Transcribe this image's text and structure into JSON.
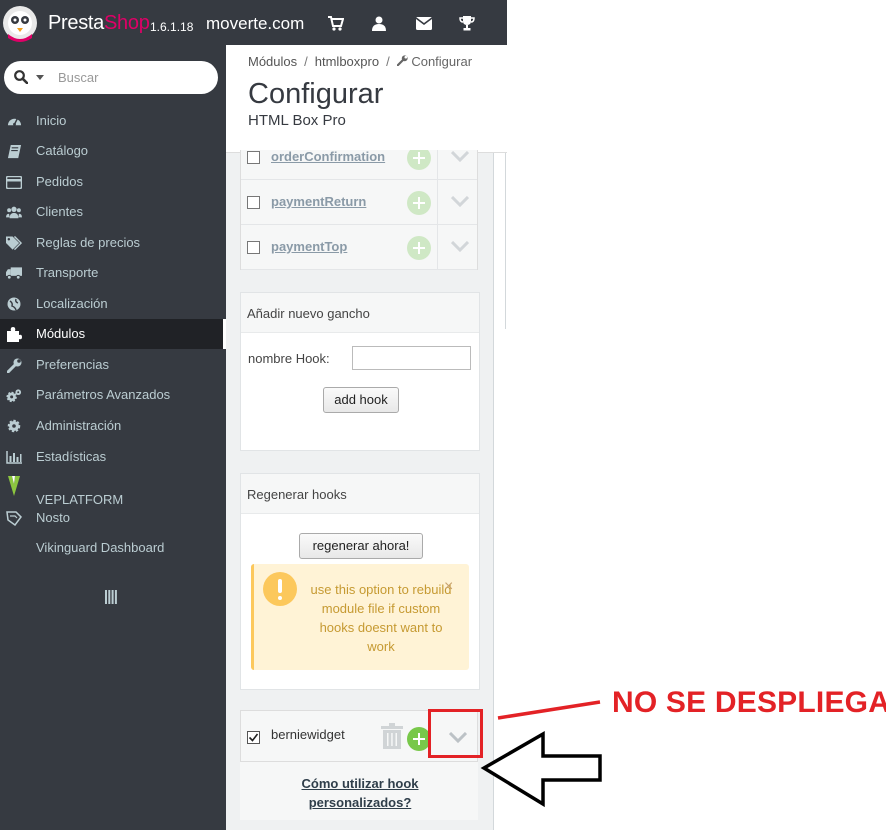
{
  "topbar": {
    "brand_presta": "Presta",
    "brand_shop": "Shop",
    "version": "1.6.1.18",
    "shop_name": "moverte.com",
    "icons": [
      "cart-icon",
      "user-icon",
      "envelope-icon",
      "trophy-icon"
    ]
  },
  "sidebar": {
    "search_placeholder": "Buscar",
    "items": [
      {
        "label": "Inicio",
        "icon": "dashboard-icon"
      },
      {
        "label": "Catálogo",
        "icon": "book-icon"
      },
      {
        "label": "Pedidos",
        "icon": "credit-card-icon"
      },
      {
        "label": "Clientes",
        "icon": "users-icon"
      },
      {
        "label": "Reglas de precios",
        "icon": "tags-icon"
      },
      {
        "label": "Transporte",
        "icon": "truck-icon"
      },
      {
        "label": "Localización",
        "icon": "globe-icon"
      },
      {
        "label": "Módulos",
        "icon": "puzzle-icon",
        "active": true
      },
      {
        "label": "Preferencias",
        "icon": "wrench-icon"
      },
      {
        "label": "Parámetros Avanzados",
        "icon": "cogs-icon"
      },
      {
        "label": "Administración",
        "icon": "cog-icon"
      },
      {
        "label": "Estadísticas",
        "icon": "bar-chart-icon"
      },
      {
        "label": "VEPLATFORM",
        "icon": "veplatform-logo-icon"
      },
      {
        "label": "Nosto",
        "icon": "nosto-icon"
      },
      {
        "label": "Vikinguard Dashboard",
        "icon": ""
      }
    ]
  },
  "header": {
    "breadcrumb": [
      "Módulos",
      "htmlboxpro",
      "Configurar"
    ],
    "title": "Configurar",
    "subtitle": "HTML Box Pro"
  },
  "hooks": [
    "orderConfirmation",
    "paymentReturn",
    "paymentTop"
  ],
  "add_hook": {
    "title": "Añadir nuevo gancho",
    "label": "nombre Hook:",
    "input_value": "",
    "button": "add hook"
  },
  "regen": {
    "title": "Regenerar hooks",
    "button": "regenerar ahora!",
    "alert": "use this option to rebuild module file if custom hooks doesnt want to work",
    "close": "×"
  },
  "custom_hook": {
    "label": "berniewidget",
    "checked": true
  },
  "help_link": "Cómo utilizar hook personalizados?",
  "annotation": {
    "text": "NO SE DESPLIEGA",
    "color": "#e32226"
  },
  "colors": {
    "sidebar_bg": "#363a41",
    "brand_pink": "#df0067",
    "alert_bg": "#fff3d6",
    "alert_icon": "#fcc85c",
    "add_green": "#78c84a"
  }
}
